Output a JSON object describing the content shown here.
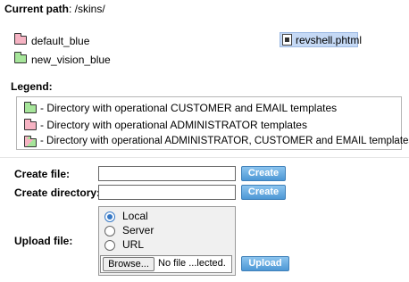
{
  "path": {
    "label": "Current path",
    "value": ": /skins/"
  },
  "directories": [
    {
      "name": "default_blue",
      "color": "pink"
    },
    {
      "name": "new_vision_blue",
      "color": "green"
    }
  ],
  "files": [
    {
      "name": "revshell.phtml",
      "icon": "php-file-icon",
      "selected": true
    }
  ],
  "legend": {
    "title": "Legend:",
    "items": [
      {
        "text": "- Directory with operational CUSTOMER and EMAIL templates",
        "color": "green"
      },
      {
        "text": "- Directory with operational ADMINISTRATOR templates",
        "color": "pink"
      },
      {
        "text": "- Directory with operational ADMINISTRATOR, CUSTOMER and EMAIL templates",
        "color": "mixed"
      }
    ]
  },
  "create_file": {
    "label": "Create file:",
    "value": "",
    "button": "Create"
  },
  "create_directory": {
    "label": "Create directory:",
    "value": "",
    "button": "Create"
  },
  "upload": {
    "label": "Upload file:",
    "options": [
      {
        "label": "Local",
        "checked": true
      },
      {
        "label": "Server",
        "checked": false
      },
      {
        "label": "URL",
        "checked": false
      }
    ],
    "browse_button": "Browse...",
    "file_status": "No file ...lected.",
    "button": "Upload"
  },
  "colors": {
    "pink": "#f6b3c3",
    "green": "#a6e59a",
    "button": "#4d97d5",
    "selection": "#c5d9f5"
  }
}
